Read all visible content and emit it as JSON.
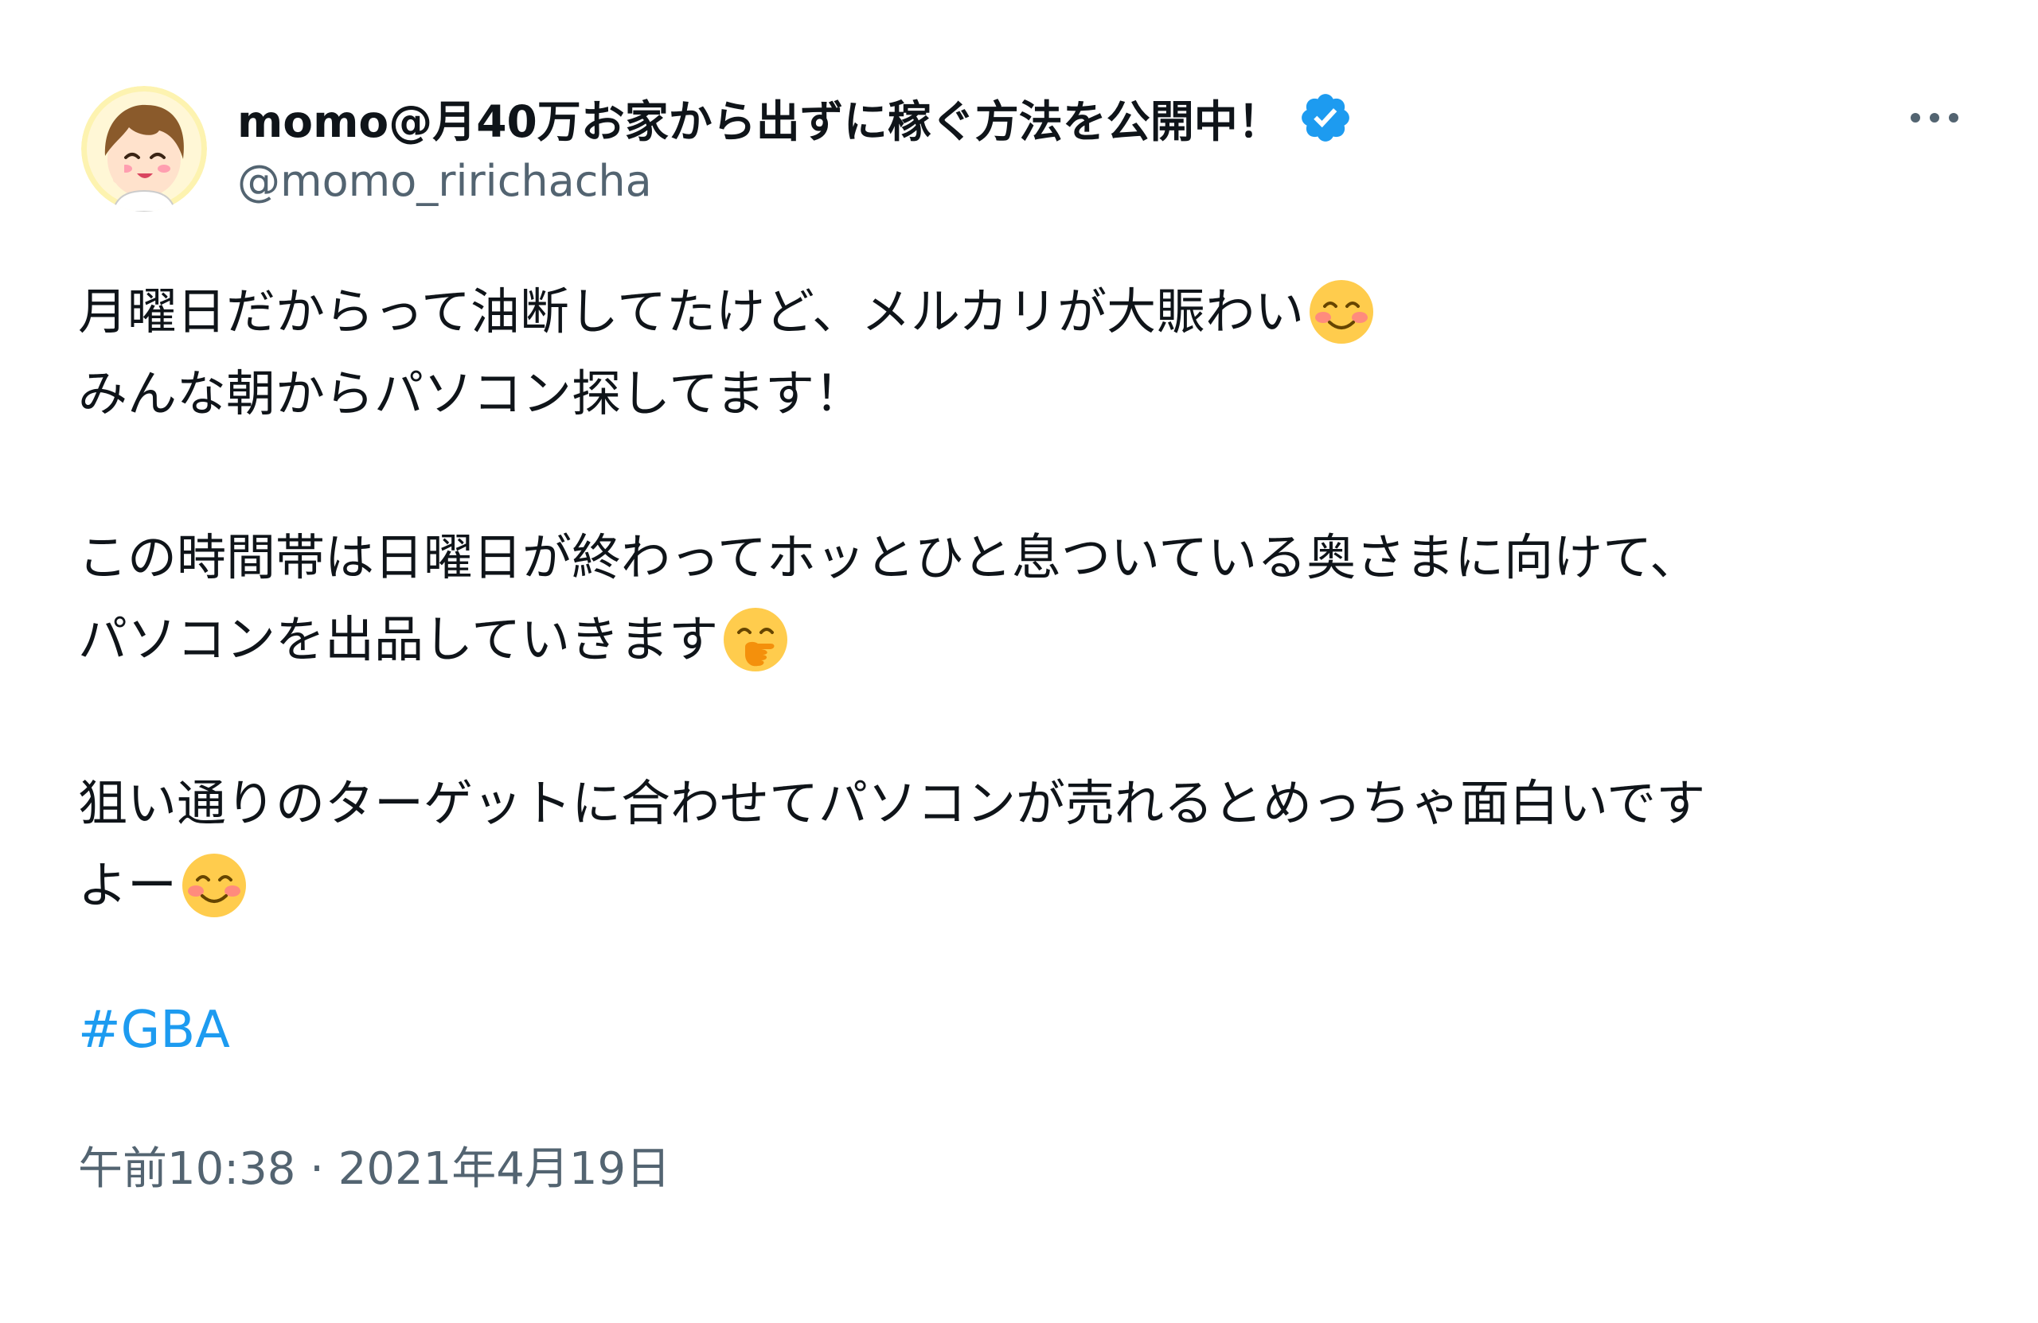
{
  "author": {
    "display_name": "momo@月40万お家から出ずに稼ぐ方法を公開中！",
    "handle": "@momo_ririchacha",
    "verified_icon": "verified-badge-icon",
    "avatar_icon": "avatar-illustration"
  },
  "menu": {
    "more_icon": "more-dots-icon"
  },
  "body": {
    "line1": "月曜日だからって油断してたけど、メルカリが大賑わい",
    "line2": "みんな朝からパソコン探してます！",
    "line3": "この時間帯は日曜日が終わってホッとひと息ついている奥さまに向けて、",
    "line4": "パソコンを出品していきます",
    "line5": "狙い通りのターゲットに合わせてパソコンが売れるとめっちゃ面白いです",
    "line6": "よー",
    "emoji_smile": "smiling-face-emoji",
    "emoji_hand_over_mouth": "hand-over-mouth-emoji"
  },
  "hashtag": "#GBA",
  "timestamp": "午前10:38 · 2021年4月19日",
  "colors": {
    "link": "#1d9bf0",
    "secondary_text": "#536471",
    "primary_text": "#0f1419"
  }
}
